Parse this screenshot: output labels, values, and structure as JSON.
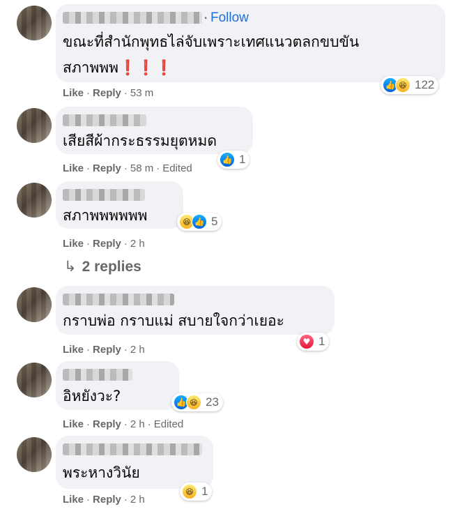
{
  "comments": [
    {
      "text": "ขณะที่สำนักพุทธไล่จับเพราะเทศแนวตลกขบขัน",
      "text2": "สภาพพพ",
      "emoji": "❗❗❗",
      "follow": "Follow",
      "like": "Like",
      "reply": "Reply",
      "time": "53 m",
      "count": "122",
      "reactions": [
        "like-icon",
        "haha-icon"
      ]
    },
    {
      "text": "เสียสีผ้ากระธรรมยุตหมด",
      "like": "Like",
      "reply": "Reply",
      "time": "58 m",
      "edited": "Edited",
      "count": "1",
      "reactions": [
        "like-icon"
      ]
    },
    {
      "text": "สภาพพพพพพ",
      "like": "Like",
      "reply": "Reply",
      "time": "2 h",
      "count": "5",
      "reactions": [
        "haha-icon",
        "like-icon"
      ]
    },
    {
      "text": "กราบพ่อ กราบแม่ สบายใจกว่าเยอะ",
      "like": "Like",
      "reply": "Reply",
      "time": "2 h",
      "count": "1",
      "reactions": [
        "love-icon"
      ]
    },
    {
      "text": "อิหยังวะ?",
      "like": "Like",
      "reply": "Reply",
      "time": "2 h",
      "edited": "Edited",
      "count": "23",
      "reactions": [
        "like-icon",
        "haha-icon"
      ]
    },
    {
      "text": "พระหางวินัย",
      "like": "Like",
      "reply": "Reply",
      "time": "2 h",
      "count": "1",
      "reactions": [
        "haha-icon"
      ]
    }
  ],
  "replies_link": "2 replies",
  "colors": {
    "bubble": "#f0f2f5",
    "link": "#216fdb",
    "meta": "#65676b"
  }
}
